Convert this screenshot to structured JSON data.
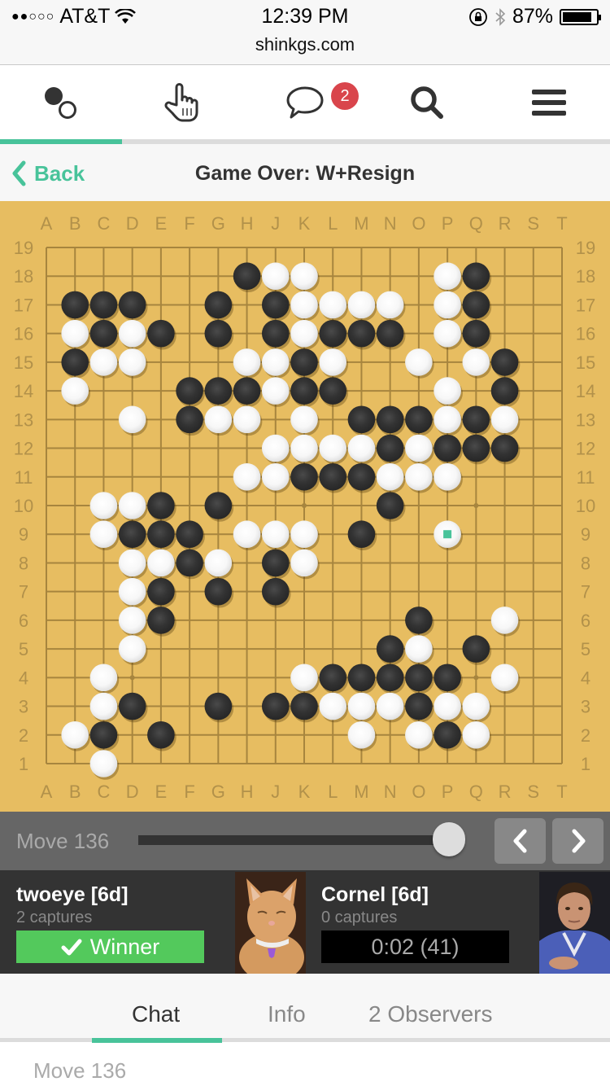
{
  "status_bar": {
    "signal_dots": "●●○○○",
    "carrier": "AT&T",
    "time": "12:39 PM",
    "battery_percent": "87%",
    "battery_level": 0.87,
    "url": "shinkgs.com"
  },
  "nav": {
    "items": [
      {
        "name": "games",
        "icon": "go-stones-icon",
        "active": true
      },
      {
        "name": "play",
        "icon": "pointing-hand-icon",
        "active": false
      },
      {
        "name": "chat",
        "icon": "speech-bubble-icon",
        "active": false,
        "badge": "2"
      },
      {
        "name": "search",
        "icon": "search-icon",
        "active": false
      },
      {
        "name": "menu",
        "icon": "hamburger-icon",
        "active": false
      }
    ],
    "accent_color": "#48c39a"
  },
  "titlebar": {
    "back_label": "Back",
    "title": "Game Over: W+Resign"
  },
  "board": {
    "size": 19,
    "columns": [
      "A",
      "B",
      "C",
      "D",
      "E",
      "F",
      "G",
      "H",
      "J",
      "K",
      "L",
      "M",
      "N",
      "O",
      "P",
      "Q",
      "R",
      "S",
      "T"
    ],
    "rows": [
      "19",
      "18",
      "17",
      "16",
      "15",
      "14",
      "13",
      "12",
      "11",
      "10",
      "9",
      "8",
      "7",
      "6",
      "5",
      "4",
      "3",
      "2",
      "1"
    ],
    "hoshi": [
      "D16",
      "K16",
      "Q16",
      "D10",
      "K10",
      "Q10",
      "D4",
      "K4",
      "Q4"
    ],
    "last_move": "P9",
    "stones": {
      "black": [
        "H18",
        "Q18",
        "B17",
        "C17",
        "D17",
        "G17",
        "J17",
        "Q17",
        "C16",
        "E16",
        "G16",
        "J16",
        "L16",
        "M16",
        "N16",
        "Q16",
        "B15",
        "K15",
        "R15",
        "F14",
        "G14",
        "H14",
        "K14",
        "L14",
        "R14",
        "F13",
        "M13",
        "N13",
        "O13",
        "Q13",
        "N12",
        "P12",
        "Q12",
        "R12",
        "K11",
        "L11",
        "M11",
        "E10",
        "G10",
        "N10",
        "D9",
        "E9",
        "F9",
        "M9",
        "F8",
        "J8",
        "E7",
        "G7",
        "J7",
        "E6",
        "O6",
        "N5",
        "Q5",
        "L4",
        "M4",
        "N4",
        "O4",
        "P4",
        "D3",
        "G3",
        "J3",
        "K3",
        "O3",
        "C2",
        "E2",
        "P2"
      ],
      "white": [
        "J18",
        "K18",
        "P18",
        "K17",
        "L17",
        "M17",
        "N17",
        "P17",
        "B16",
        "D16",
        "K16",
        "P16",
        "C15",
        "D15",
        "H15",
        "J15",
        "L15",
        "O15",
        "Q15",
        "B14",
        "J14",
        "P14",
        "D13",
        "G13",
        "H13",
        "K13",
        "P13",
        "R13",
        "J12",
        "K12",
        "L12",
        "M12",
        "O12",
        "H11",
        "J11",
        "N11",
        "O11",
        "P11",
        "C10",
        "D10",
        "C9",
        "H9",
        "J9",
        "K9",
        "P9",
        "D8",
        "E8",
        "G8",
        "K8",
        "D7",
        "D6",
        "R6",
        "D5",
        "O5",
        "C4",
        "K4",
        "R4",
        "C3",
        "L3",
        "M3",
        "N3",
        "P3",
        "Q3",
        "B2",
        "M2",
        "O2",
        "Q2",
        "C1"
      ]
    }
  },
  "controls": {
    "move_label": "Move 136",
    "move_current": 136,
    "move_total": 136,
    "prev_icon": "chevron-left-icon",
    "next_icon": "chevron-right-icon"
  },
  "players": {
    "black": {
      "name": "twoeye [6d]",
      "captures": "2 captures",
      "result_label": "Winner",
      "avatar": "orange-cat-photo"
    },
    "white": {
      "name": "Cornel [6d]",
      "captures": "0 captures",
      "clock": "0:02 (41)",
      "avatar": "man-in-blue-shirt-photo"
    }
  },
  "tabs": [
    {
      "label": "Chat",
      "active": true
    },
    {
      "label": "Info",
      "active": false
    },
    {
      "label": "2 Observers",
      "active": false
    }
  ],
  "chat": {
    "lines": [
      "Move 136"
    ]
  }
}
